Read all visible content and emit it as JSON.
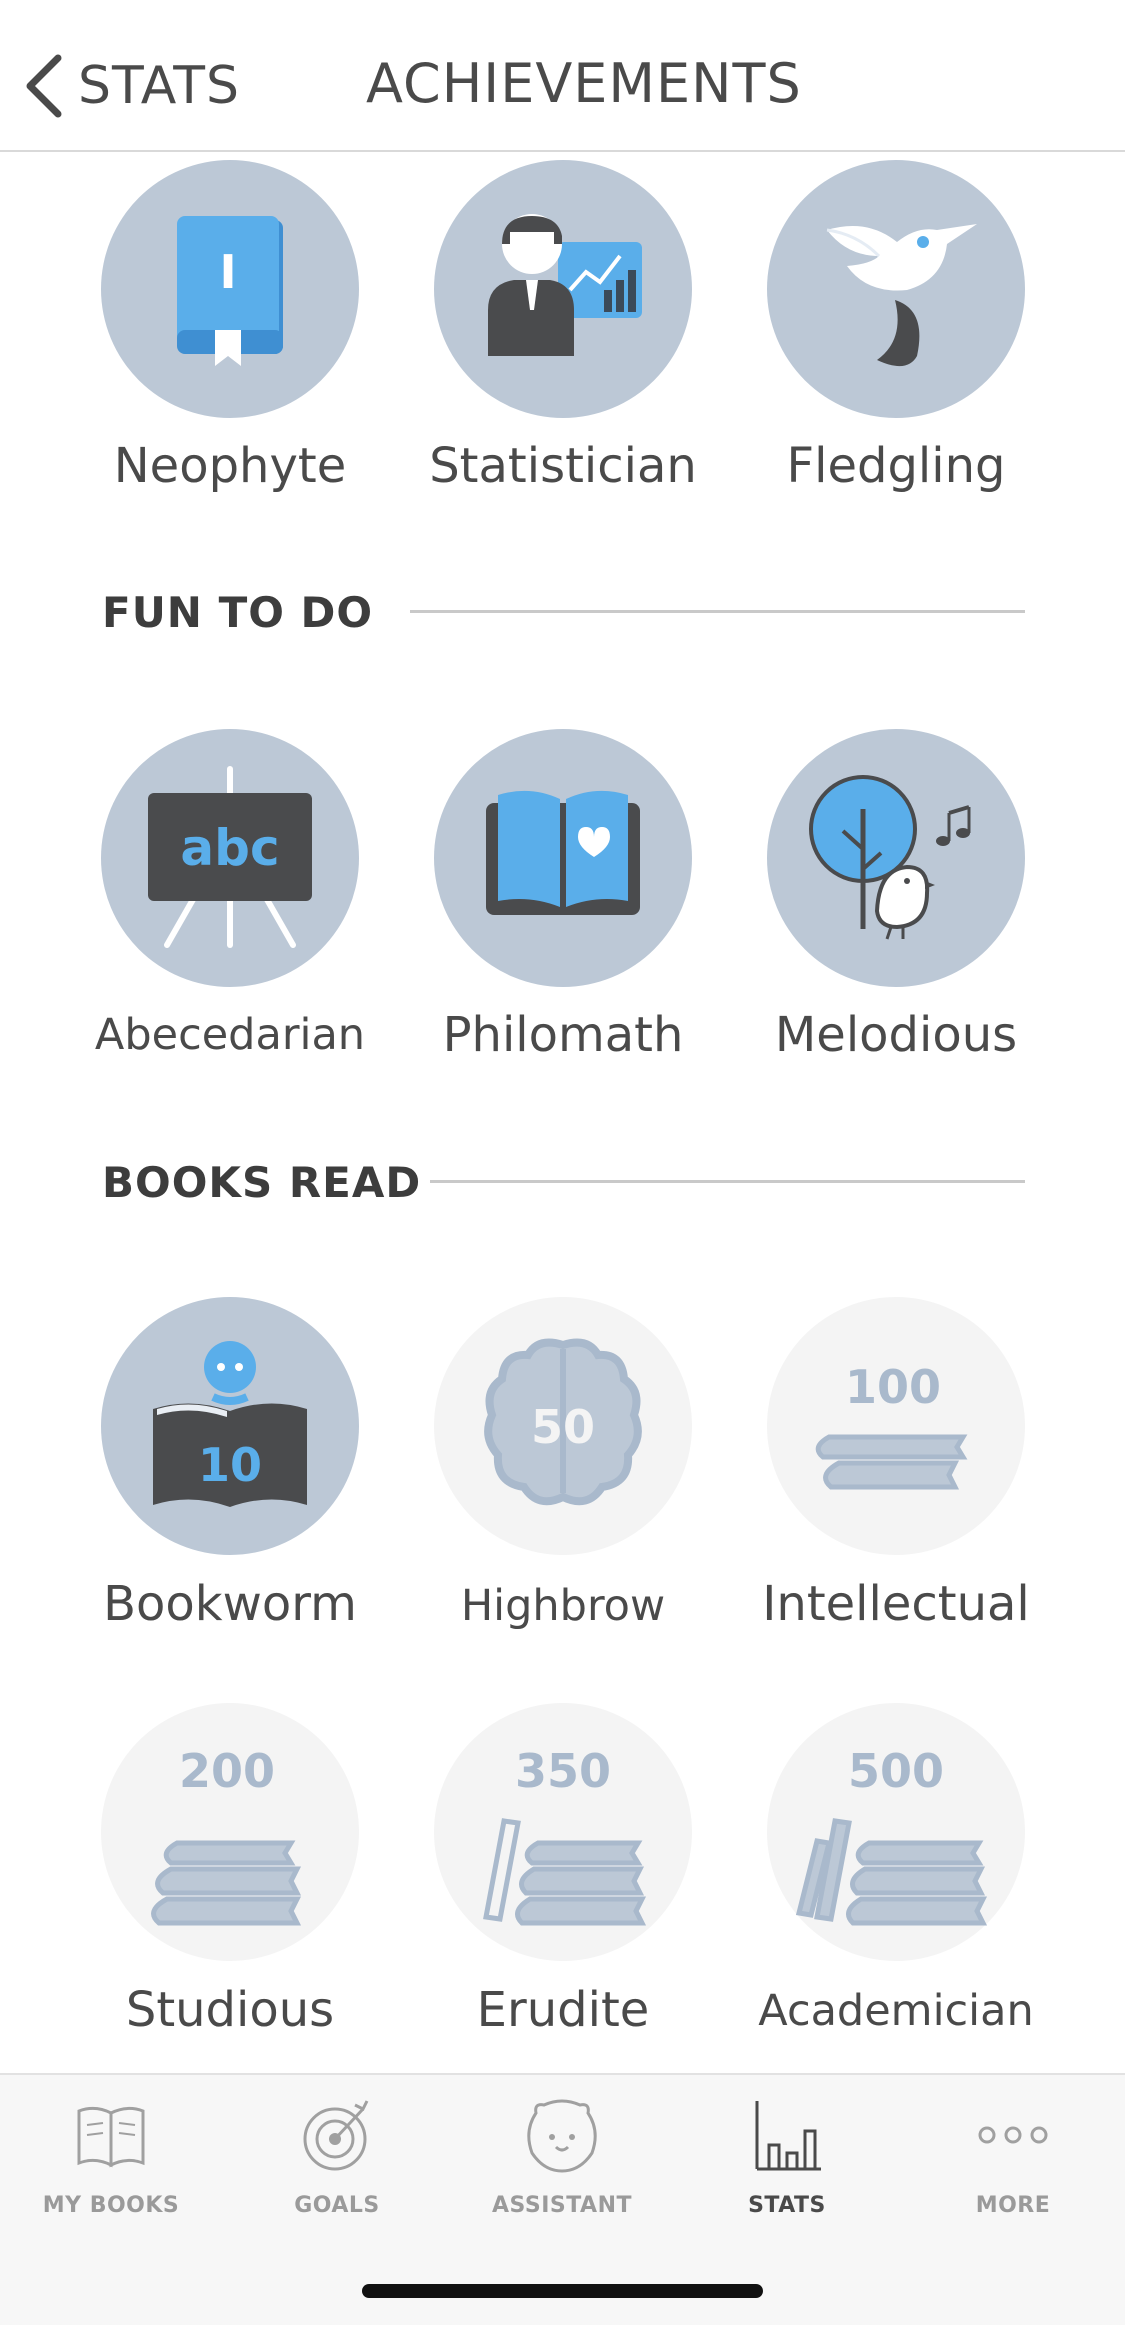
{
  "header": {
    "back_label": "STATS",
    "title": "ACHIEVEMENTS"
  },
  "sections": [
    {
      "heading": "FUN TO DO"
    },
    {
      "heading": "BOOKS READ"
    }
  ],
  "badges": {
    "neophyte": "Neophyte",
    "statistician": "Statistician",
    "fledgling": "Fledgling",
    "abecedarian": "Abecedarian",
    "abecedarian_board": "abc",
    "philomath": "Philomath",
    "melodious": "Melodious",
    "bookworm": "Bookworm",
    "bookworm_count": "10",
    "highbrow": "Highbrow",
    "highbrow_count": "50",
    "intellectual": "Intellectual",
    "intellectual_count": "100",
    "studious": "Studious",
    "studious_count": "200",
    "erudite": "Erudite",
    "erudite_count": "350",
    "academician": "Academician",
    "academician_count": "500",
    "neophyte_book_letter": "I"
  },
  "tabs": [
    {
      "label": "MY BOOKS"
    },
    {
      "label": "GOALS"
    },
    {
      "label": "ASSISTANT"
    },
    {
      "label": "STATS"
    },
    {
      "label": "MORE"
    }
  ],
  "colors": {
    "badge_bg": "#bcc8d6",
    "badge_locked_bg": "#f4f4f4",
    "accent_blue": "#5aaeea",
    "dark": "#4a4b4d",
    "locked_icon": "#a9b9cc"
  }
}
